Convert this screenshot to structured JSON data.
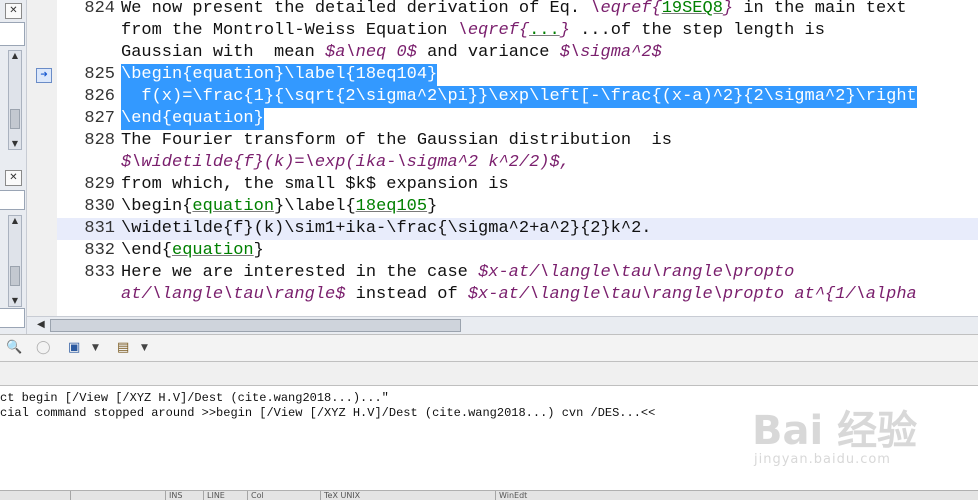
{
  "editor": {
    "lines": [
      {
        "num": "824",
        "segments": [
          {
            "t": "We now present the detailed derivation of Eq. ",
            "c": "plain"
          },
          {
            "t": "\\eqref{",
            "c": "math"
          },
          {
            "t": "19SEQ8",
            "c": "kw"
          },
          {
            "t": "}",
            "c": "math"
          },
          {
            "t": " in the main text",
            "c": "plain"
          }
        ]
      },
      {
        "num": "",
        "segments": [
          {
            "t": "from the Montroll-Weiss Equation ",
            "c": "plain"
          },
          {
            "t": "\\eqref{",
            "c": "math"
          },
          {
            "t": "...",
            "c": "kw"
          },
          {
            "t": "}",
            "c": "math"
          },
          {
            "t": " ...of the step length is",
            "c": "plain"
          }
        ]
      },
      {
        "num": "",
        "segments": [
          {
            "t": "Gaussian with  mean ",
            "c": "plain"
          },
          {
            "t": "$a\\neq 0$",
            "c": "math"
          },
          {
            "t": " and variance ",
            "c": "plain"
          },
          {
            "t": "$\\sigma^2$",
            "c": "math"
          }
        ]
      },
      {
        "num": "825",
        "selected": true,
        "segments": [
          {
            "t": "\\begin{equation}\\label{18eq104}",
            "c": "plain"
          }
        ]
      },
      {
        "num": "826",
        "selected": true,
        "segments": [
          {
            "t": "  f(x)=\\frac{1}{\\sqrt{2\\sigma^2\\pi}}\\exp\\left[-\\frac{(x-a)^2}{2\\sigma^2}\\right",
            "c": "plain"
          }
        ]
      },
      {
        "num": "827",
        "selected": true,
        "segments": [
          {
            "t": "\\end{equation}",
            "c": "plain"
          }
        ]
      },
      {
        "num": "828",
        "segments": [
          {
            "t": "The Fourier transform of the Gaussian distribution  is",
            "c": "plain"
          }
        ]
      },
      {
        "num": "",
        "segments": [
          {
            "t": "$\\widetilde{f}(k)=\\exp(ika-\\sigma^2 k^2/2)$,",
            "c": "math"
          }
        ]
      },
      {
        "num": "829",
        "segments": [
          {
            "t": "from which, the small $k$ expansion is",
            "c": "plain"
          }
        ]
      },
      {
        "num": "830",
        "segments": [
          {
            "t": "\\begin{",
            "c": "plain"
          },
          {
            "t": "equation",
            "c": "kw"
          },
          {
            "t": "}\\label{",
            "c": "plain"
          },
          {
            "t": "18eq105",
            "c": "kw"
          },
          {
            "t": "}",
            "c": "plain"
          }
        ]
      },
      {
        "num": "831",
        "current": true,
        "segments": [
          {
            "t": "\\widetilde{f}(k)\\sim1+ika-\\frac{\\sigma^2+a^2}{2}k^2.",
            "c": "plain"
          }
        ]
      },
      {
        "num": "832",
        "segments": [
          {
            "t": "\\end{",
            "c": "plain"
          },
          {
            "t": "equation",
            "c": "kw"
          },
          {
            "t": "}",
            "c": "plain"
          }
        ]
      },
      {
        "num": "833",
        "segments": [
          {
            "t": "Here we are interested in the case ",
            "c": "plain"
          },
          {
            "t": "$x-at/\\langle\\tau\\rangle\\propto",
            "c": "math"
          }
        ]
      },
      {
        "num": "",
        "segments": [
          {
            "t": "at/\\langle\\tau\\rangle$",
            "c": "math"
          },
          {
            "t": " instead of ",
            "c": "plain"
          },
          {
            "t": "$x-at/\\langle\\tau\\rangle\\propto at^{1/\\alpha",
            "c": "math"
          }
        ]
      }
    ]
  },
  "log": {
    "lines": [
      "ct begin [/View [/XYZ H.V]/Dest (cite.wang2018...)...\"",
      "cial command stopped around >>begin [/View [/XYZ H.V]/Dest (cite.wang2018...) cvn /DES...<<"
    ]
  },
  "icons": {
    "left_close_1": "close-icon",
    "left_close_2": "close-icon",
    "bookmark": "arrow-right-icon"
  },
  "toolbar": {
    "buttons": [
      "search-icon",
      "circle-icon",
      "monitor-icon",
      "dropdown-icon",
      "clipboard-icon",
      "dropdown-icon"
    ]
  },
  "statusbar": {
    "segments": [
      "",
      "INS",
      "LINE",
      "Col",
      "TeX UNIX",
      "WinEdt"
    ]
  },
  "watermark": {
    "brand": "Bai 经验",
    "site": "jingyan.baidu.com"
  },
  "colors": {
    "selection": "#3399ff",
    "keyword_green": "#008000",
    "math_purple": "#7a1f6d",
    "current_line": "#e8ecfb"
  }
}
